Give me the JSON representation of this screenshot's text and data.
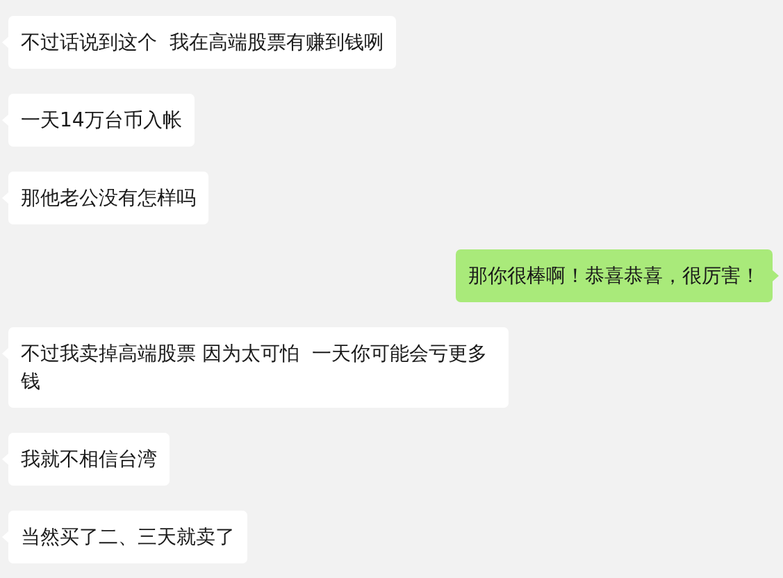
{
  "messages": [
    {
      "kind": "incoming",
      "text": "不过话说到这个  我在高端股票有赚到钱咧"
    },
    {
      "kind": "incoming",
      "text": "一天14万台币入帐"
    },
    {
      "kind": "incoming",
      "text": "那他老公没有怎样吗"
    },
    {
      "kind": "outgoing",
      "text": "那你很棒啊！恭喜恭喜，很厉害！"
    },
    {
      "kind": "incoming",
      "text": "不过我卖掉高端股票 因为太可怕  一天你可能会亏更多钱"
    },
    {
      "kind": "incoming",
      "text": "我就不相信台湾"
    },
    {
      "kind": "incoming",
      "text": "当然买了二、三天就卖了"
    }
  ]
}
